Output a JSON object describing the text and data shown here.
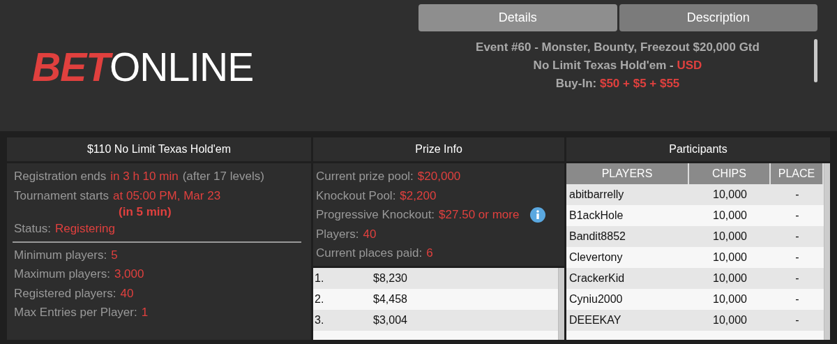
{
  "logo": {
    "part_1": "BET",
    "part_2": "ONLINE"
  },
  "tabs": [
    {
      "label": "Details",
      "selected": true
    },
    {
      "label": "Description",
      "selected": false
    }
  ],
  "description": [
    {
      "label": "Event #60 - Monster, Bounty, Freezout $20,000 Gtd"
    },
    {
      "label": "No Limit Texas Hold'em - ",
      "value": "USD"
    },
    {
      "label": "Buy-In: ",
      "value": "$50 + $5 + $55"
    }
  ],
  "tournament": {
    "title": "$110 No Limit Texas Hold'em",
    "lines": [
      {
        "label": "Registration ends",
        "value": "in 3 h 10 min",
        "note": "(after 17 levels)"
      },
      {
        "label": "Tournament starts",
        "value": "at 05:00 PM, Mar 23",
        "sub": "(in 5 min)"
      },
      {
        "label": "Status:",
        "value": "Registering"
      },
      {
        "kind": "divider"
      },
      {
        "label": "Minimum players:",
        "value": "5"
      },
      {
        "label": "Maximum players:",
        "value": "3,000"
      },
      {
        "label": "Registered players:",
        "value": "40"
      },
      {
        "label": "Max Entries per Player:",
        "value": "1"
      }
    ]
  },
  "prize_info": {
    "title": "Prize Info",
    "lines": [
      {
        "label": "Current prize pool:",
        "value": "$20,000"
      },
      {
        "label": "Knockout Pool:",
        "value": "$2,200"
      },
      {
        "label": "Progressive Knockout:",
        "value": "$27.50 or more",
        "info": true
      },
      {
        "label": "Players:",
        "value": "40"
      },
      {
        "label": "Current places paid:",
        "value": "6"
      }
    ],
    "payouts": [
      {
        "place": "1.",
        "amount": "$8,230"
      },
      {
        "place": "2.",
        "amount": "$4,458"
      },
      {
        "place": "3.",
        "amount": "$3,004"
      }
    ]
  },
  "participants": {
    "title": "Participants",
    "columns": [
      "PLAYERS",
      "CHIPS",
      "PLACE"
    ],
    "rows": [
      [
        "abitbarrelly",
        "10,000",
        "-"
      ],
      [
        "B1ackHole",
        "10,000",
        "-"
      ],
      [
        "Bandit8852",
        "10,000",
        "-"
      ],
      [
        "Clevertony",
        "10,000",
        "-"
      ],
      [
        "CrackerKid",
        "10,000",
        "-"
      ],
      [
        "Cyniu2000",
        "10,000",
        "-"
      ],
      [
        "DEEEKAY",
        "10,000",
        "-"
      ]
    ]
  }
}
